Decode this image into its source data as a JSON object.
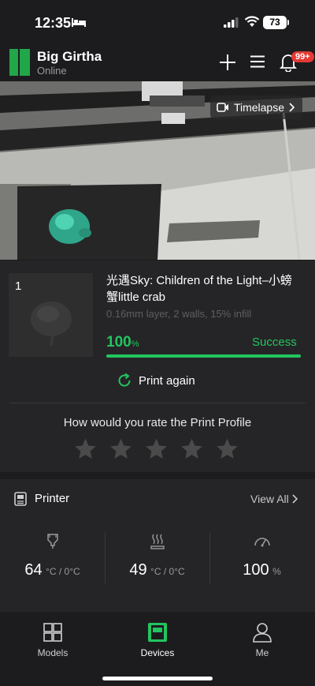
{
  "status_bar": {
    "time": "12:35",
    "battery": "73"
  },
  "header": {
    "printer_name": "Big Girtha",
    "printer_status": "Online",
    "notification_badge": "99+"
  },
  "camera": {
    "timelapse_label": "Timelapse"
  },
  "job": {
    "plate_number": "1",
    "title": "光遇Sky: Children of the Light–小螃蟹little crab",
    "details": "0.16mm layer, 2 walls, 15% infill",
    "progress_value": "100",
    "progress_unit": "%",
    "progress_fraction": 1.0,
    "status": "Success",
    "print_again_label": "Print again",
    "rate_prompt": "How would you rate the Print Profile",
    "star_count": 5
  },
  "printer_section": {
    "title": "Printer",
    "view_all_label": "View All",
    "stats": [
      {
        "value": "64",
        "unit": "°C / 0°C",
        "icon": "nozzle-temperature-icon"
      },
      {
        "value": "49",
        "unit": "°C / 0°C",
        "icon": "bed-temperature-icon"
      },
      {
        "value": "100",
        "unit": "%",
        "icon": "speed-gauge-icon"
      }
    ]
  },
  "tabs": [
    {
      "label": "Models",
      "icon": "models-icon",
      "active": false
    },
    {
      "label": "Devices",
      "icon": "devices-icon",
      "active": true
    },
    {
      "label": "Me",
      "icon": "profile-icon",
      "active": false
    }
  ],
  "colors": {
    "accent": "#22c55e",
    "background": "#1c1c1e",
    "card": "#252527",
    "badge": "#e53935"
  }
}
